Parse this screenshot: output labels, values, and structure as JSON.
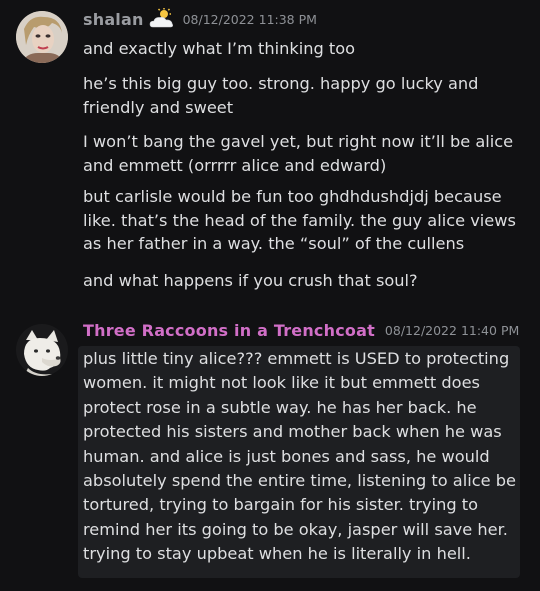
{
  "messages": [
    {
      "username": "shalan",
      "username_color": "#9a9ca1",
      "badge_icon": "sun-behind-cloud-icon",
      "timestamp": "08/12/2022 11:38 PM",
      "lines": [
        "and exactly what I’m thinking too",
        "he’s this big guy too. strong. happy go lucky and\nfriendly and sweet",
        "I won’t bang the gavel yet, but right now it’ll be alice\nand emmett (orrrrr alice and edward)",
        "but carlisle would be fun too ghdhdushdjdj because\nlike. that’s the head of the family. the guy alice views\nas her father in a way. the “soul” of the cullens",
        "and what happens if you crush that soul?"
      ]
    },
    {
      "username": "Three Raccoons in a Trenchcoat",
      "username_color": "#d16fc7",
      "timestamp": "08/12/2022 11:40 PM",
      "text": "plus little tiny alice??? emmett is USED to protecting\nwomen. it might not look like it but emmett does\nprotect rose in a subtle way. he has her back. he\nprotected his sisters and mother back when he was\nhuman. and alice is just bones and sass, he would\nabsolutely spend the entire time, listening to alice be\ntortured, trying to bargain for his sister. trying to\nremind her its going to be okay, jasper will save her.\ntrying to stay upbeat when he is literally in hell."
    }
  ]
}
